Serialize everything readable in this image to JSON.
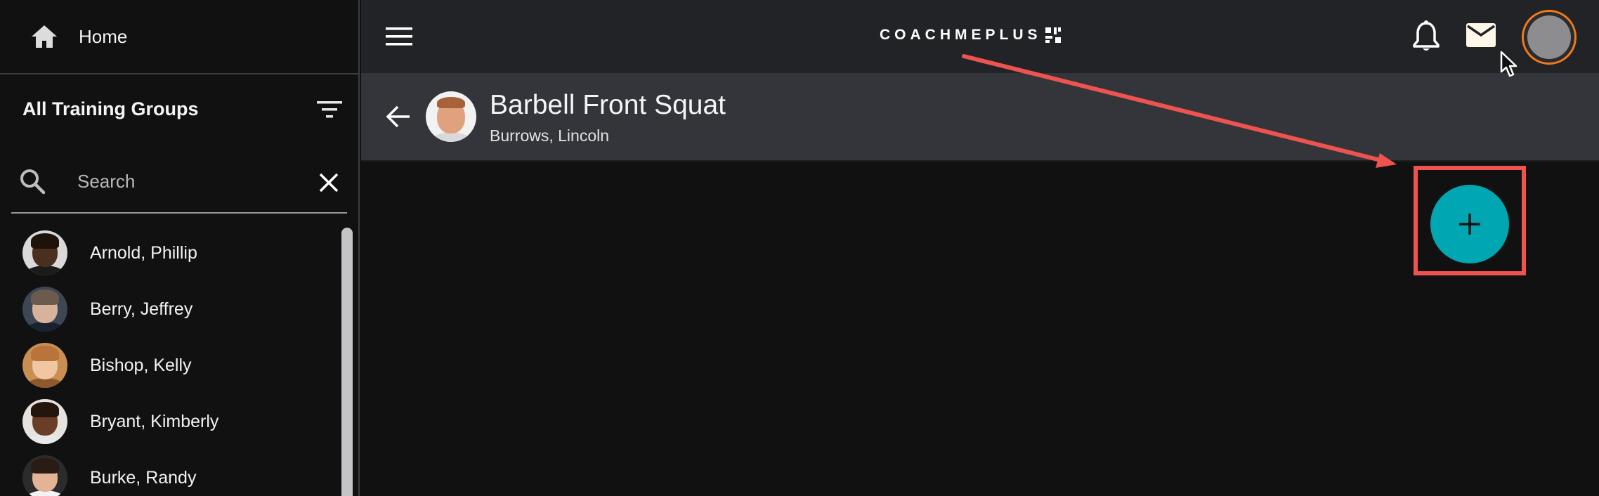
{
  "sidebar": {
    "home_label": "Home",
    "group_title": "All Training Groups",
    "search": {
      "placeholder": "Search",
      "value": ""
    },
    "athletes": [
      {
        "name": "Arnold, Phillip"
      },
      {
        "name": "Berry, Jeffrey"
      },
      {
        "name": "Bishop, Kelly"
      },
      {
        "name": "Bryant, Kimberly"
      },
      {
        "name": "Burke, Randy"
      }
    ]
  },
  "topbar": {
    "brand": "COACHMEPLUS",
    "icons": [
      "menu-icon",
      "bell-icon",
      "mail-icon",
      "profile-avatar"
    ]
  },
  "header": {
    "exercise_title": "Barbell Front Squat",
    "athlete_name": "Burrows, Lincoln"
  },
  "actions": {
    "add_icon": "plus-icon"
  },
  "colors": {
    "background": "#111112",
    "topbar": "#222326",
    "header": "#33353a",
    "accent": "#00a6b1",
    "annotation": "#ef5350",
    "avatar_ring": "#f07a1a"
  }
}
